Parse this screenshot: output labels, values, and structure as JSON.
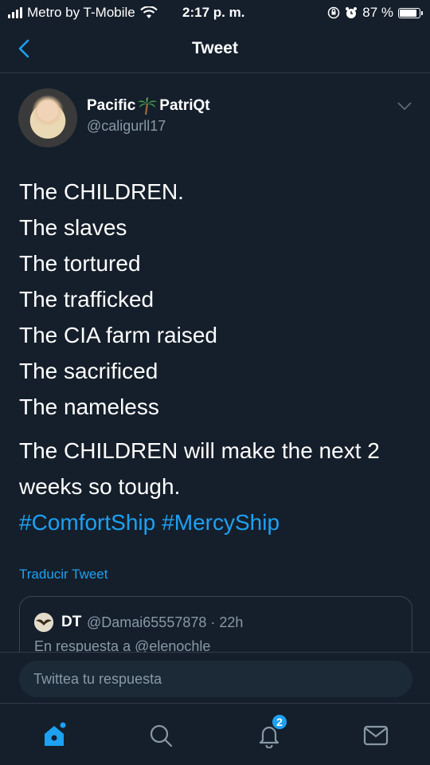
{
  "status_bar": {
    "carrier": "Metro by T-Mobile",
    "time": "2:17 p. m.",
    "battery_percent": "87 %",
    "battery_level": 0.87
  },
  "nav": {
    "title": "Tweet"
  },
  "tweet": {
    "author_name_part1": "Pacific",
    "author_name_part2": "PatriQt",
    "author_handle": "@caligurll17",
    "lines": [
      "The CHILDREN.",
      "The slaves",
      "The tortured",
      "The trafficked",
      "The CIA farm raised",
      "The sacrificed",
      "The nameless"
    ],
    "paragraph_line1": "The CHILDREN will make the next 2",
    "paragraph_line2": "weeks so tough.",
    "hashtags": [
      "#ComfortShip",
      "#MercyShip"
    ],
    "translate_label": "Traducir Tweet"
  },
  "reply": {
    "name": "DT",
    "handle_time": "@Damai65557878 · 22h",
    "context": "En respuesta a @elenochle"
  },
  "compose": {
    "placeholder": "Twittea tu respuesta"
  },
  "tab_bar": {
    "notification_count": "2"
  },
  "colors": {
    "background": "#151f2b",
    "accent": "#1da1f2",
    "secondary_text": "#8899a6"
  }
}
